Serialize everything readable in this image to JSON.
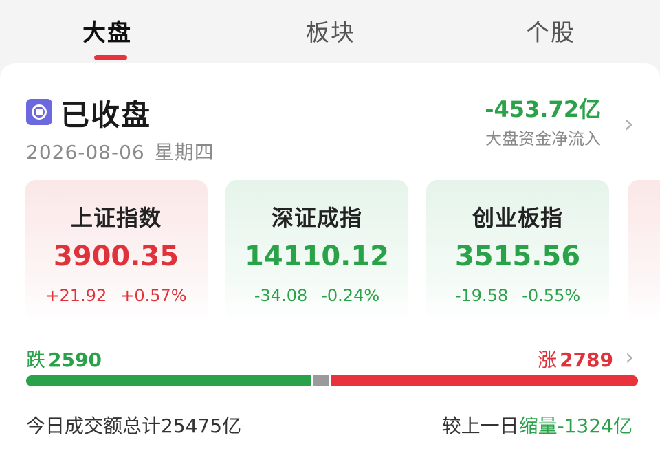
{
  "tabs": [
    {
      "label": "大盘",
      "active": true
    },
    {
      "label": "板块",
      "active": false
    },
    {
      "label": "个股",
      "active": false
    }
  ],
  "status": {
    "icon": "stop-circle-icon",
    "text": "已收盘",
    "date": "2026-08-06",
    "weekday": "星期四"
  },
  "net_flow": {
    "value": "-453.72亿",
    "label": "大盘资金净流入"
  },
  "indices": [
    {
      "name": "上证指数",
      "value": "3900.35",
      "change": "+21.92",
      "change_pct": "+0.57%",
      "trend": "up"
    },
    {
      "name": "深证成指",
      "value": "14110.12",
      "change": "-34.08",
      "change_pct": "-0.24%",
      "trend": "down"
    },
    {
      "name": "创业板指",
      "value": "3515.56",
      "change": "-19.58",
      "change_pct": "-0.55%",
      "trend": "down"
    }
  ],
  "breadth": {
    "fall_label": "跌",
    "fall_count": "2590",
    "rise_label": "涨",
    "rise_count": "2789"
  },
  "volume": {
    "total_label": "今日成交额总计",
    "total_value": "25475亿",
    "compare_label": "较上一日",
    "compare_type": "缩量",
    "compare_value": "-1324亿"
  },
  "colors": {
    "rise": "#e0323b",
    "fall": "#2aa24a",
    "flat": "#9a9a9a",
    "status_icon": "#6c68dd",
    "tab_indicator": "#e8333d"
  }
}
